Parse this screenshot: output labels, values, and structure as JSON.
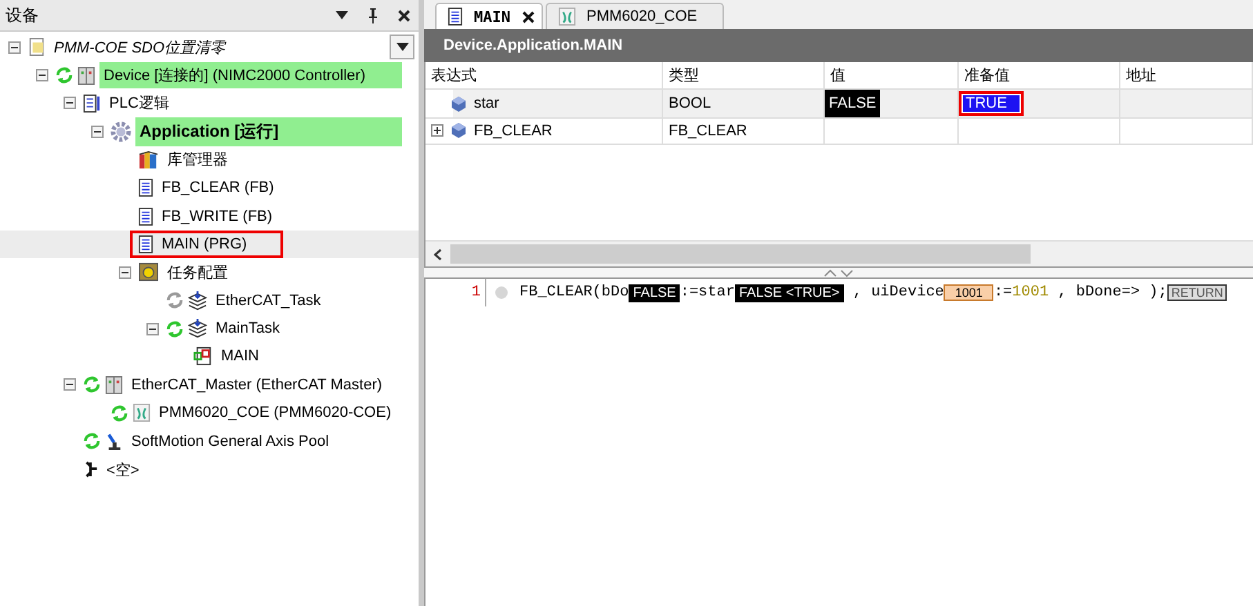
{
  "devices_panel": {
    "title": "设备",
    "tree": [
      {
        "label": "PMM-COE SDO位置清零",
        "kind": "project",
        "italic": true,
        "expanded": true,
        "children": [
          {
            "label": "Device [连接的] (NIMC2000 Controller)",
            "kind": "device",
            "connected": true,
            "highlighted": true,
            "expanded": true,
            "children": [
              {
                "label": "PLC逻辑",
                "kind": "plc",
                "expanded": true,
                "children": [
                  {
                    "label": "Application [运行]",
                    "kind": "application",
                    "bold": true,
                    "highlighted": true,
                    "expanded": true,
                    "children": [
                      {
                        "label": "库管理器",
                        "kind": "library"
                      },
                      {
                        "label": "FB_CLEAR (FB)",
                        "kind": "pou"
                      },
                      {
                        "label": "FB_WRITE (FB)",
                        "kind": "pou"
                      },
                      {
                        "label": "MAIN (PRG)",
                        "kind": "pou",
                        "selected": true,
                        "boxed": true
                      },
                      {
                        "label": "任务配置",
                        "kind": "taskconfig",
                        "expanded": true,
                        "children": [
                          {
                            "label": "EtherCAT_Task",
                            "kind": "task",
                            "connected": false
                          },
                          {
                            "label": "MainTask",
                            "kind": "task",
                            "connected": true,
                            "expanded": true,
                            "children": [
                              {
                                "label": "MAIN",
                                "kind": "call"
                              }
                            ]
                          }
                        ]
                      }
                    ]
                  }
                ]
              },
              {
                "label": "EtherCAT_Master (EtherCAT Master)",
                "kind": "device",
                "connected": true,
                "expanded": true,
                "children": [
                  {
                    "label": "PMM6020_COE (PMM6020-COE)",
                    "kind": "drive",
                    "connected": true
                  }
                ]
              },
              {
                "label": "SoftMotion General Axis Pool",
                "kind": "axis",
                "connected": true
              },
              {
                "label": "<空>",
                "kind": "slot"
              }
            ]
          }
        ]
      }
    ]
  },
  "editor_tabs": [
    {
      "label": "MAIN",
      "kind": "pou",
      "selected": true,
      "closable": true
    },
    {
      "label": "PMM6020_COE",
      "kind": "drive",
      "selected": false,
      "closable": false
    }
  ],
  "watch": {
    "title": "Device.Application.MAIN",
    "columns": [
      "表达式",
      "类型",
      "值",
      "准备值",
      "地址"
    ],
    "rows": [
      {
        "expression": "star",
        "type": "BOOL",
        "value": "FALSE",
        "prepared": "TRUE",
        "boxed": true
      },
      {
        "expression": "FB_CLEAR",
        "type": "FB_CLEAR",
        "expanded": false
      }
    ]
  },
  "code": {
    "lines": [
      {
        "number": "1",
        "segments": [
          {
            "kind": "code",
            "text": "FB_CLEAR(bDo"
          },
          {
            "kind": "value",
            "text": "FALSE"
          },
          {
            "kind": "code",
            "text": ":=star"
          },
          {
            "kind": "value",
            "text": "FALSE <TRUE>"
          },
          {
            "kind": "code",
            "text": " , uiDevice"
          },
          {
            "kind": "number",
            "text": "1001"
          },
          {
            "kind": "code",
            "text": ":="
          },
          {
            "kind": "literal",
            "text": "1001"
          },
          {
            "kind": "code",
            "text": " , bDone=> );"
          },
          {
            "kind": "return",
            "text": "RETURN"
          }
        ]
      }
    ]
  }
}
